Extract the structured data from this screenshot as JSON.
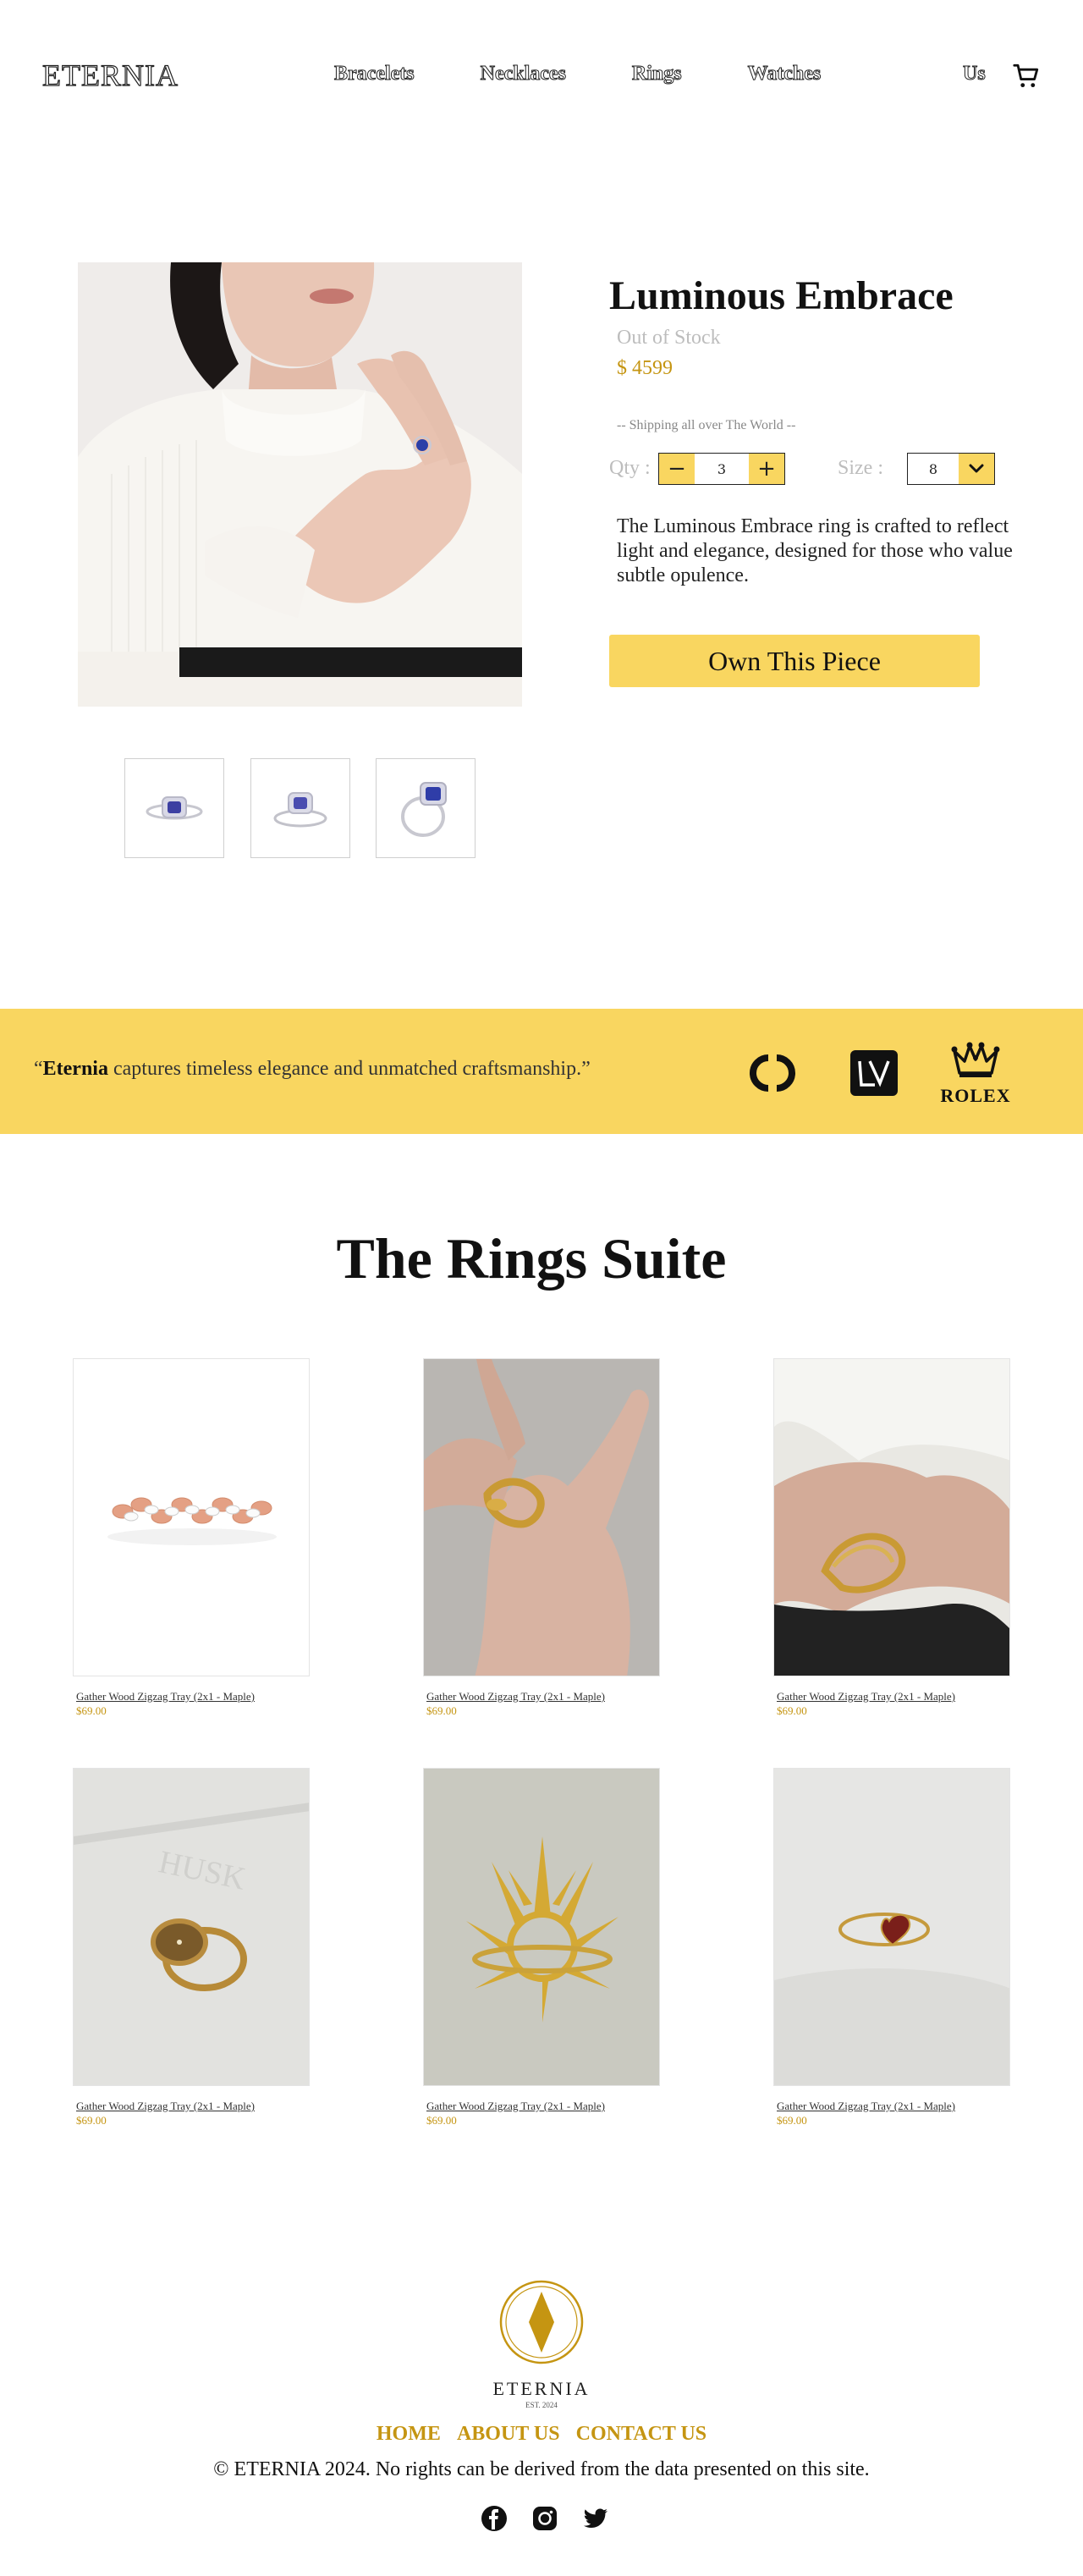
{
  "header": {
    "logo": "ETERNIA",
    "nav": [
      "Bracelets",
      "Necklaces",
      "Rings",
      "Watches"
    ],
    "us_label": "Us",
    "cart_icon": "cart-icon"
  },
  "product": {
    "title": "Luminous Embrace",
    "stock": "Out of Stock",
    "price": "$ 4599",
    "shipping": "-- Shipping all over The World --",
    "qty_label": "Qty :",
    "qty_value": "3",
    "qty_minus": "−",
    "qty_plus": "+",
    "size_label": "Size :",
    "size_value": "8",
    "description": "The Luminous Embrace ring is crafted to reflect light and elegance, designed for those who value subtle opulence.",
    "cta": "Own This Piece"
  },
  "banner": {
    "quote_open": "“",
    "quote_brand": "Eternia",
    "quote_rest": " captures timeless elegance and unmatched craftsmanship.”",
    "rolex_text": "ROLEX"
  },
  "suite": {
    "title": "The Rings Suite",
    "items": [
      {
        "name": "Gather Wood Zigzag Tray (2x1 - Maple)",
        "price": "$69.00"
      },
      {
        "name": "Gather Wood Zigzag Tray (2x1 - Maple)",
        "price": "$69.00"
      },
      {
        "name": "Gather Wood Zigzag Tray (2x1 - Maple)",
        "price": "$69.00"
      },
      {
        "name": "Gather Wood Zigzag Tray (2x1 - Maple)",
        "price": "$69.00"
      },
      {
        "name": "Gather Wood Zigzag Tray (2x1 - Maple)",
        "price": "$69.00"
      },
      {
        "name": "Gather Wood Zigzag Tray (2x1 - Maple)",
        "price": "$69.00"
      }
    ]
  },
  "footer": {
    "logo_text": "ETERNIA",
    "logo_est": "EST. 2024",
    "links": [
      "HOME",
      "ABOUT US",
      "CONTACT US"
    ],
    "copyright": "© ETERNIA 2024.  No rights can be derived from the data presented on this site.",
    "social_icons": [
      "facebook-icon",
      "instagram-icon",
      "twitter-icon"
    ]
  },
  "colors": {
    "accent": "#f9d660",
    "gold_text": "#c59512",
    "muted": "#bdbdbd"
  }
}
